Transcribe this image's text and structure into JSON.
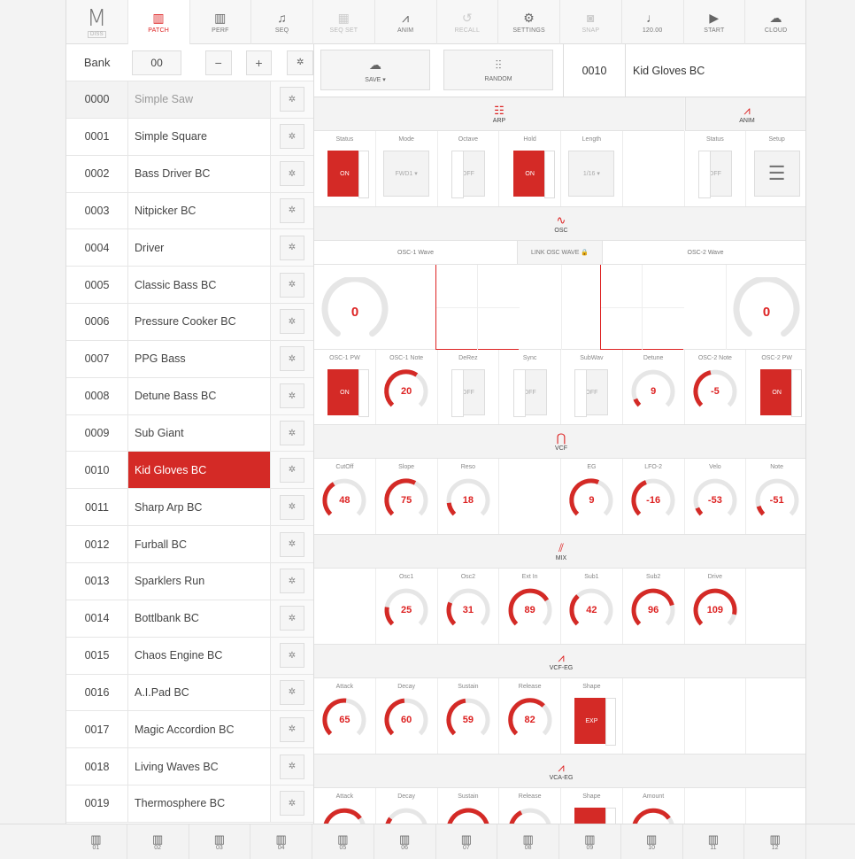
{
  "nav": [
    {
      "label": "",
      "icon": "moog-logo"
    },
    {
      "label": "PATCH",
      "icon": "keyboard-icon",
      "active": true
    },
    {
      "label": "PERF",
      "icon": "keyboard-icon"
    },
    {
      "label": "SEQ",
      "icon": "notes-icon"
    },
    {
      "label": "SEQ SET",
      "icon": "grid-icon",
      "dim": true
    },
    {
      "label": "ANIM",
      "icon": "anim-icon"
    },
    {
      "label": "RECALL",
      "icon": "recall-icon",
      "dim": true
    },
    {
      "label": "SETTINGS",
      "icon": "settings-icon"
    },
    {
      "label": "SNAP",
      "icon": "camera-icon",
      "dim": true
    },
    {
      "label": "120.00",
      "icon": "tempo-icon"
    },
    {
      "label": "START",
      "icon": "play-icon"
    },
    {
      "label": "CLOUD",
      "icon": "cloud-icon"
    }
  ],
  "logo": {
    "sub": "DISS"
  },
  "bank": {
    "label": "Bank",
    "value": "00",
    "minus": "−",
    "plus": "+",
    "gear": "✲"
  },
  "patches": [
    {
      "num": "0000",
      "name": "Simple Saw"
    },
    {
      "num": "0001",
      "name": "Simple Square"
    },
    {
      "num": "0002",
      "name": "Bass Driver BC"
    },
    {
      "num": "0003",
      "name": "Nitpicker BC"
    },
    {
      "num": "0004",
      "name": "Driver"
    },
    {
      "num": "0005",
      "name": "Classic Bass BC"
    },
    {
      "num": "0006",
      "name": "Pressure Cooker BC"
    },
    {
      "num": "0007",
      "name": "PPG Bass"
    },
    {
      "num": "0008",
      "name": "Detune Bass BC"
    },
    {
      "num": "0009",
      "name": "Sub Giant"
    },
    {
      "num": "0010",
      "name": "Kid Gloves BC"
    },
    {
      "num": "0011",
      "name": "Sharp Arp BC"
    },
    {
      "num": "0012",
      "name": "Furball BC"
    },
    {
      "num": "0013",
      "name": "Sparklers Run"
    },
    {
      "num": "0014",
      "name": "Bottlbank BC"
    },
    {
      "num": "0015",
      "name": "Chaos Engine BC"
    },
    {
      "num": "0016",
      "name": "A.I.Pad BC"
    },
    {
      "num": "0017",
      "name": "Magic Accordion BC"
    },
    {
      "num": "0018",
      "name": "Living Waves BC"
    },
    {
      "num": "0019",
      "name": "Thermosphere BC"
    }
  ],
  "active_patch": "0010",
  "toolbar": {
    "save": "SAVE ▾",
    "random": "RANDOM",
    "current_num": "0010",
    "current_name": "Kid Gloves BC"
  },
  "sections": {
    "arp": "ARP",
    "anim": "ANIM",
    "osc": "OSC",
    "vcf": "VCF",
    "mix": "MIX",
    "vcf_eg": "VCF-EG",
    "vca_eg": "VCA-EG"
  },
  "arp": {
    "status": {
      "label": "Status",
      "value": "ON"
    },
    "mode": {
      "label": "Mode",
      "value": "FWD1 ▾"
    },
    "octave": {
      "label": "Octave",
      "value": "OFF"
    },
    "hold": {
      "label": "Hold",
      "value": "ON"
    },
    "length": {
      "label": "Length",
      "value": "1/16 ▾"
    }
  },
  "anim": {
    "status": {
      "label": "Status",
      "value": "OFF"
    },
    "setup": {
      "label": "Setup"
    }
  },
  "osc_waves": {
    "osc1": "OSC-1 Wave",
    "link": "LINK OSC WAVE 🔒",
    "osc2": "OSC-2 Wave"
  },
  "osc_wave_values": {
    "osc1": "0",
    "osc2": "0"
  },
  "osc": [
    {
      "label": "OSC-1 PW",
      "type": "toggle",
      "value": "ON"
    },
    {
      "label": "OSC-1 Note",
      "type": "knob",
      "value": "20",
      "pct": 0.62
    },
    {
      "label": "DeRez",
      "type": "toggle",
      "value": "OFF"
    },
    {
      "label": "Sync",
      "type": "toggle",
      "value": "OFF"
    },
    {
      "label": "SubWav",
      "type": "toggle",
      "value": "OFF"
    },
    {
      "label": "Detune",
      "type": "knob",
      "value": "9",
      "pct": 0.08
    },
    {
      "label": "OSC-2 Note",
      "type": "knob",
      "value": "-5",
      "pct": 0.45
    },
    {
      "label": "OSC-2 PW",
      "type": "toggle",
      "value": "ON"
    }
  ],
  "vcf": [
    {
      "label": "CutOff",
      "value": "48",
      "pct": 0.38
    },
    {
      "label": "Slope",
      "value": "75",
      "pct": 0.6
    },
    {
      "label": "Reso",
      "value": "18",
      "pct": 0.14
    },
    {
      "label": "",
      "value": "",
      "pct": -1
    },
    {
      "label": "EG",
      "value": "9",
      "pct": 0.58
    },
    {
      "label": "LFO-2",
      "value": "-16",
      "pct": 0.42
    },
    {
      "label": "Velo",
      "value": "-53",
      "pct": 0.08
    },
    {
      "label": "Note",
      "value": "-51",
      "pct": 0.1
    }
  ],
  "mix": [
    {
      "label": "",
      "value": "",
      "pct": -1
    },
    {
      "label": "Osc1",
      "value": "25",
      "pct": 0.2
    },
    {
      "label": "Osc2",
      "value": "31",
      "pct": 0.25
    },
    {
      "label": "Ext In",
      "value": "89",
      "pct": 0.72
    },
    {
      "label": "Sub1",
      "value": "42",
      "pct": 0.34
    },
    {
      "label": "Sub2",
      "value": "96",
      "pct": 0.78
    },
    {
      "label": "Drive",
      "value": "109",
      "pct": 0.88
    },
    {
      "label": "",
      "value": "",
      "pct": -1
    }
  ],
  "vcf_eg": [
    {
      "label": "Attack",
      "value": "65",
      "pct": 0.52
    },
    {
      "label": "Decay",
      "value": "60",
      "pct": 0.48
    },
    {
      "label": "Sustain",
      "value": "59",
      "pct": 0.47
    },
    {
      "label": "Release",
      "value": "82",
      "pct": 0.66
    },
    {
      "label": "Shape",
      "type": "toggle",
      "value": "EXP"
    }
  ],
  "vca_eg": [
    {
      "label": "Attack",
      "value": "",
      "pct": 0.7
    },
    {
      "label": "Decay",
      "value": "",
      "pct": 0.3
    },
    {
      "label": "Sustain",
      "value": "",
      "pct": 0.9
    },
    {
      "label": "Release",
      "value": "",
      "pct": 0.4
    },
    {
      "label": "Shape",
      "type": "toggle",
      "value": ""
    },
    {
      "label": "Amount",
      "value": "",
      "pct": 0.7
    }
  ],
  "bottom": [
    "01",
    "02",
    "03",
    "04",
    "05",
    "06",
    "07",
    "08",
    "09",
    "10",
    "11",
    "12"
  ],
  "colors": {
    "accent": "#d42a26",
    "track": "#e6e6e6"
  }
}
